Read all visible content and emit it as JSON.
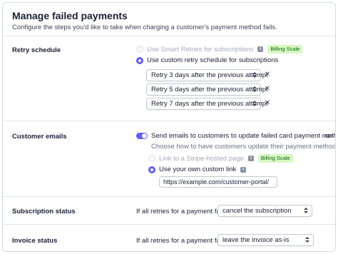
{
  "header": {
    "title": "Manage failed payments",
    "subtitle": "Configure the steps you'd like to take when charging a customer's payment method fails."
  },
  "retry": {
    "label": "Retry schedule",
    "smart_option": "Use Smart Retries for subscriptions",
    "smart_badge": "Billing Scale",
    "custom_option": "Use custom retry schedule for subscriptions",
    "schedules": [
      "Retry 3 days after the previous attempt",
      "Retry 5 days after the previous attempt",
      "Retry 7 days after the previous attempt"
    ],
    "remove_glyph": "✕"
  },
  "emails": {
    "label": "Customer emails",
    "toggle_label": "Send emails to customers to update failed card payment methods",
    "toggle_on": true,
    "helper": "Choose how to have customers update their payment method",
    "hosted_option": "Link to a Stripe-hosted page",
    "hosted_badge": "Billing Scale",
    "custom_link_option": "Use your own custom link",
    "custom_link_value": "https://example.com/customer-portal/"
  },
  "subscription": {
    "label": "Subscription status",
    "prefix": "If all retries for a payment fail,",
    "selected": "cancel the subscription"
  },
  "invoice": {
    "label": "Invoice status",
    "prefix": "If all retries for a payment fail,",
    "selected": "leave the invoice as-is"
  },
  "colors": {
    "accent": "#635bff",
    "badge_bg": "#d7f7c2",
    "badge_text": "#05690d"
  },
  "icons": {
    "info": "info-icon",
    "eye": "eye-icon",
    "caret": "select-caret-icon"
  }
}
